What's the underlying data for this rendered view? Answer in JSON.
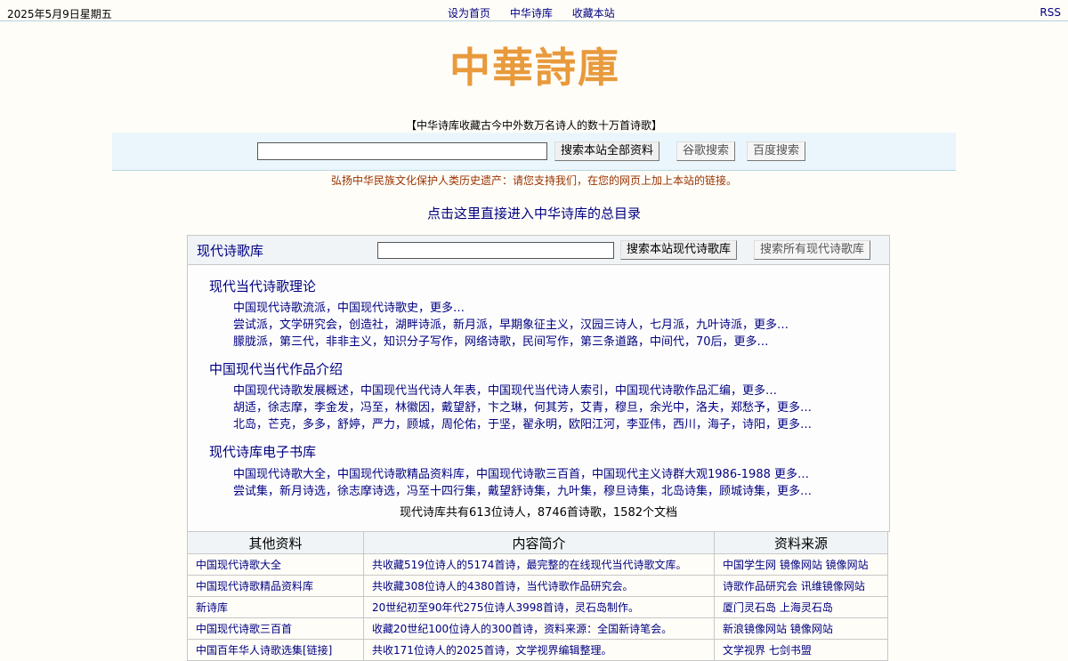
{
  "topbar": {
    "date": "2025年5月9日星期五",
    "nav": [
      "设为首页",
      "中华诗库",
      "收藏本站"
    ],
    "rss": "RSS"
  },
  "logo": {
    "text": "中華詩庫",
    "color": "#e89a3c"
  },
  "tagline": "【中华诗库收藏古今中外数万名诗人的数十万首诗歌】",
  "search": {
    "value": "",
    "buttons": [
      "搜索本站全部资料",
      "谷歌搜索",
      "百度搜索"
    ]
  },
  "appeal": "弘扬中华民族文化保护人类历史遗产：请您支持我们，在您的网页上加上本站的链接。",
  "catalog_link": "点击这里直接进入中华诗库的总目录",
  "modern": {
    "title": "现代诗歌库",
    "search_value": "",
    "buttons": [
      "搜索本站现代诗歌库",
      "搜索所有现代诗歌库"
    ],
    "sections": [
      {
        "title": "现代当代诗歌理论",
        "lines": [
          "中国现代诗歌流派，中国现代诗歌史，更多…",
          "尝试派，文学研究会，创造社，湖畔诗派，新月派，早期象征主义，汉园三诗人，七月派，九叶诗派，更多…",
          "朦胧派，第三代，非非主义，知识分子写作，网络诗歌，民间写作，第三条道路，中间代，70后，更多…"
        ]
      },
      {
        "title": "中国现代当代作品介绍",
        "lines": [
          "中国现代诗歌发展概述，中国现代当代诗人年表，中国现代当代诗人索引，中国现代诗歌作品汇编，更多…",
          "胡适，徐志摩，李金发，冯至，林徽因，戴望舒，卞之琳，何其芳，艾青，穆旦，余光中，洛夫，郑愁予，更多…",
          "北岛，芒克，多多，舒婷，严力，顾城，周伦佑，于坚，翟永明，欧阳江河，李亚伟，西川，海子，诗阳，更多…"
        ]
      },
      {
        "title": "现代诗库电子书库",
        "lines": [
          "中国现代诗歌大全，中国现代诗歌精品资料库，中国现代诗歌三百首，中国现代主义诗群大观1986-1988 更多…",
          "尝试集，新月诗选，徐志摩诗选，冯至十四行集，戴望舒诗集，九叶集，穆旦诗集，北岛诗集，顾城诗集，更多…"
        ]
      }
    ],
    "summary": "现代诗库共有613位诗人，8746首诗歌，1582个文档"
  },
  "table": {
    "headers": [
      "其他资料",
      "内容简介",
      "资料来源"
    ],
    "rows": [
      [
        "中国现代诗歌大全",
        "共收藏519位诗人的5174首诗，最完整的在线现代当代诗歌文库。",
        "中国学生网 镜像网站 镜像网站"
      ],
      [
        "中国现代诗歌精品资料库",
        "共收藏308位诗人的4380首诗，当代诗歌作品研究会。",
        "诗歌作品研究会 讯维镜像网站"
      ],
      [
        "新诗库",
        "20世纪初至90年代275位诗人3998首诗，灵石岛制作。",
        "厦门灵石岛 上海灵石岛"
      ],
      [
        "中国现代诗歌三百首",
        "收藏20世纪100位诗人的300首诗，资料来源：全国新诗笔会。",
        "新浪镜像网站 镜像网站"
      ],
      [
        "中国百年华人诗歌选集[链接]",
        "共收171位诗人的2025首诗，文学视界编辑整理。",
        "文学视界 七剑书盟"
      ]
    ]
  }
}
